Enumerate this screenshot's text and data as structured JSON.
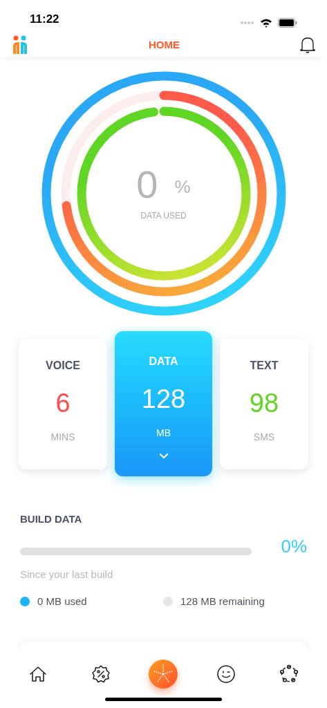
{
  "status_bar": {
    "time": "11:22"
  },
  "header": {
    "title": "HOME"
  },
  "usage_rings": [
    {
      "color": "#2aa8f5"
    },
    {
      "color": "#ff5a4a"
    },
    {
      "color": "#5fd624"
    }
  ],
  "usage_center": {
    "value": "0",
    "unit": "%",
    "label": "DATA USED"
  },
  "plans": [
    {
      "title": "VOICE",
      "amount": "6",
      "unit": "MINS",
      "color": "#ff4d4d",
      "selected": false
    },
    {
      "title": "DATA",
      "amount": "128",
      "unit": "MB",
      "color": "#ffffff",
      "selected": true
    },
    {
      "title": "TEXT",
      "amount": "98",
      "unit": "SMS",
      "color": "#5fd624",
      "selected": false
    }
  ],
  "build_data": {
    "title": "BUILD DATA",
    "level": 0,
    "percent": "0%",
    "caption": "Since your last build",
    "legend": [
      {
        "label": "0 MB used",
        "color": "#1bb4f7"
      },
      {
        "label": "128 MB remaining",
        "color": "#e6e6e8"
      }
    ]
  },
  "tab_bar": [
    {
      "kind": "home",
      "selected": false
    },
    {
      "kind": "offers",
      "selected": false
    },
    {
      "kind": "build",
      "selected": true
    },
    {
      "kind": "wink",
      "selected": false
    },
    {
      "kind": "community",
      "selected": false
    }
  ]
}
